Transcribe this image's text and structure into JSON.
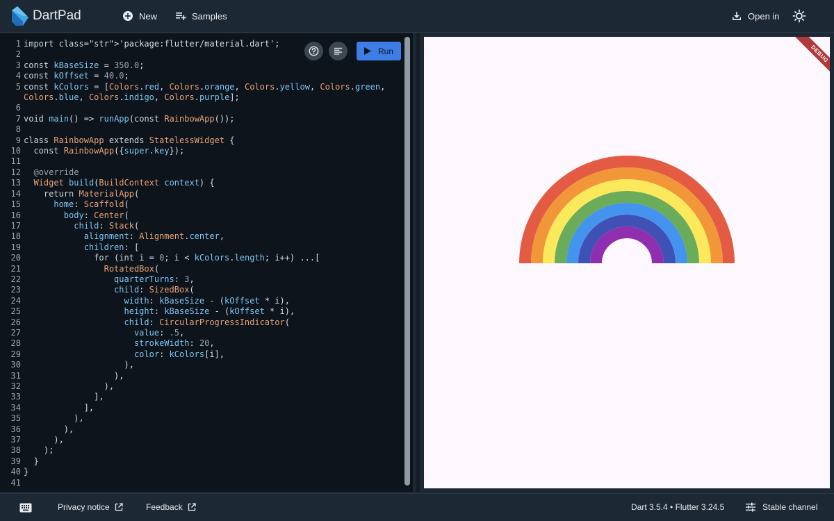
{
  "header": {
    "app_title": "DartPad",
    "new_label": "New",
    "samples_label": "Samples",
    "open_in_label": "Open in"
  },
  "editor": {
    "run_label": "Run",
    "line_numbers": [
      "1",
      "2",
      "3",
      "4",
      "5",
      "",
      "6",
      "7",
      "8",
      "9",
      "10",
      "11",
      "12",
      "13",
      "14",
      "15",
      "16",
      "17",
      "18",
      "19",
      "20",
      "21",
      "22",
      "23",
      "24",
      "25",
      "26",
      "27",
      "28",
      "29",
      "30",
      "31",
      "32",
      "33",
      "34",
      "35",
      "36",
      "37",
      "38",
      "39",
      "40",
      "41"
    ],
    "code_lines": [
      "import 'package:flutter/material.dart';",
      "",
      "const kBaseSize = 350.0;",
      "const kOffset = 40.0;",
      "const kColors = [Colors.red, Colors.orange, Colors.yellow, Colors.green,",
      "Colors.blue, Colors.indigo, Colors.purple];",
      "",
      "void main() => runApp(const RainbowApp());",
      "",
      "class RainbowApp extends StatelessWidget {",
      "  const RainbowApp({super.key});",
      "",
      "  @override",
      "  Widget build(BuildContext context) {",
      "    return MaterialApp(",
      "      home: Scaffold(",
      "        body: Center(",
      "          child: Stack(",
      "            alignment: Alignment.center,",
      "            children: [",
      "              for (int i = 0; i < kColors.length; i++) ...[",
      "                RotatedBox(",
      "                  quarterTurns: 3,",
      "                  child: SizedBox(",
      "                    width: kBaseSize - (kOffset * i),",
      "                    height: kBaseSize - (kOffset * i),",
      "                    child: CircularProgressIndicator(",
      "                      value: .5,",
      "                      strokeWidth: 20,",
      "                      color: kColors[i],",
      "                    ),",
      "                  ),",
      "                ),",
      "              ],",
      "            ],",
      "          ),",
      "        ),",
      "      ),",
      "    );",
      "  }",
      "}",
      ""
    ]
  },
  "preview": {
    "debug_label": "DEBUG",
    "rainbow_colors": [
      "#e35b43",
      "#f2963a",
      "#fbe95b",
      "#6aac59",
      "#4493ee",
      "#3f51b5",
      "#8f2fb0"
    ]
  },
  "footer": {
    "privacy_label": "Privacy notice",
    "feedback_label": "Feedback",
    "version_text": "Dart 3.5.4 • Flutter 3.24.5",
    "channel_label": "Stable channel"
  }
}
